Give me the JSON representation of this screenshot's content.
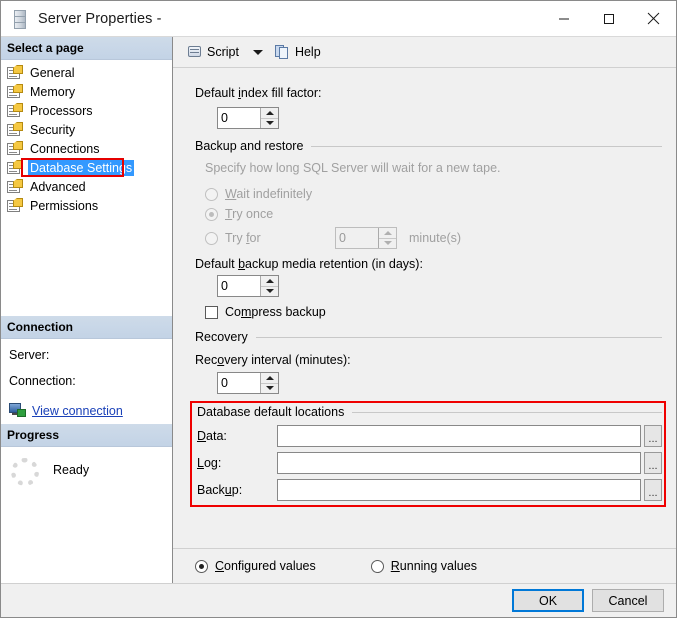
{
  "window": {
    "title": "Server Properties -",
    "icon": "server-icon",
    "controls": {
      "minimize": "minimize-icon",
      "maximize": "maximize-icon",
      "close": "close-icon"
    }
  },
  "sidebar": {
    "select_a_page_header": "Select a page",
    "pages": [
      {
        "label": "General",
        "selected": false
      },
      {
        "label": "Memory",
        "selected": false
      },
      {
        "label": "Processors",
        "selected": false
      },
      {
        "label": "Security",
        "selected": false
      },
      {
        "label": "Connections",
        "selected": false
      },
      {
        "label": "Database Settings",
        "selected": true
      },
      {
        "label": "Advanced",
        "selected": false
      },
      {
        "label": "Permissions",
        "selected": false
      }
    ],
    "connection": {
      "header": "Connection",
      "server_label": "Server:",
      "server_value": "",
      "connection_label": "Connection:",
      "connection_value": "",
      "view_connection_link": "View connection "
    },
    "progress": {
      "header": "Progress",
      "status": "Ready"
    }
  },
  "toolbar": {
    "script_label": "Script",
    "help_label": "Help",
    "script_icon": "script-icon",
    "dropdown_icon": "chevron-down-icon",
    "help_icon": "help-icon"
  },
  "main": {
    "fill_factor": {
      "label_pre": "Default ",
      "label_accel": "i",
      "label_post": "ndex fill factor:",
      "label_full": "Default index fill factor:",
      "value": "0"
    },
    "backup_restore": {
      "group_label": "Backup and restore",
      "description": "Specify how long SQL Server will wait for a new tape.",
      "options": [
        {
          "label_full": "Wait indefinitely",
          "pre": "",
          "accel": "W",
          "post": "ait indefinitely",
          "selected": false,
          "disabled": true
        },
        {
          "label_full": "Try once",
          "pre": "",
          "accel": "T",
          "post": "ry once",
          "selected": true,
          "disabled": true
        },
        {
          "label_full": "Try for",
          "pre": "Try ",
          "accel": "f",
          "post": "or",
          "selected": false,
          "disabled": true
        }
      ],
      "try_for_value": "0",
      "minutes_label": "minute(s)",
      "media_retention": {
        "label_pre": "Default ",
        "label_accel": "b",
        "label_post": "ackup media retention (in days):",
        "label_full": "Default backup media retention (in days):",
        "value": "0"
      },
      "compress_backup": {
        "label_pre": "Co",
        "label_accel": "m",
        "label_post": "press backup",
        "label_full": "Compress backup",
        "checked": false
      }
    },
    "recovery": {
      "group_label": "Recovery",
      "interval_label_pre": "Rec",
      "interval_label_accel": "o",
      "interval_label_post": "very interval (minutes):",
      "interval_label_full": "Recovery interval (minutes):",
      "interval_value": "0"
    },
    "default_locations": {
      "group_label": "Database default locations",
      "highlighted": true,
      "highlight_color": "#ef0000",
      "rows": [
        {
          "label_pre": "",
          "label_accel": "D",
          "label_post": "ata:",
          "label_full": "Data:",
          "value": "",
          "browse_label": "..."
        },
        {
          "label_pre": "",
          "label_accel": "L",
          "label_post": "og:",
          "label_full": "Log:",
          "value": "",
          "browse_label": "..."
        },
        {
          "label_pre": "Back",
          "label_accel": "u",
          "label_post": "p:",
          "label_full": "Backup:",
          "value": "",
          "browse_label": "..."
        }
      ]
    },
    "value_mode": {
      "configured": {
        "pre": "",
        "accel": "C",
        "post": "onfigured values",
        "label_full": "Configured values",
        "selected": true
      },
      "running": {
        "pre": "",
        "accel": "R",
        "post": "unning values",
        "label_full": "Running values",
        "selected": false
      }
    }
  },
  "footer": {
    "ok_label": "OK",
    "cancel_label": "Cancel"
  },
  "colors": {
    "selection_blue": "#3399ff",
    "highlight_red": "#ef0000",
    "link_blue": "#1a41b8",
    "panel_gray": "#f0f0f0",
    "section_header": "#c9d7e8",
    "default_button_border": "#0078d7"
  }
}
